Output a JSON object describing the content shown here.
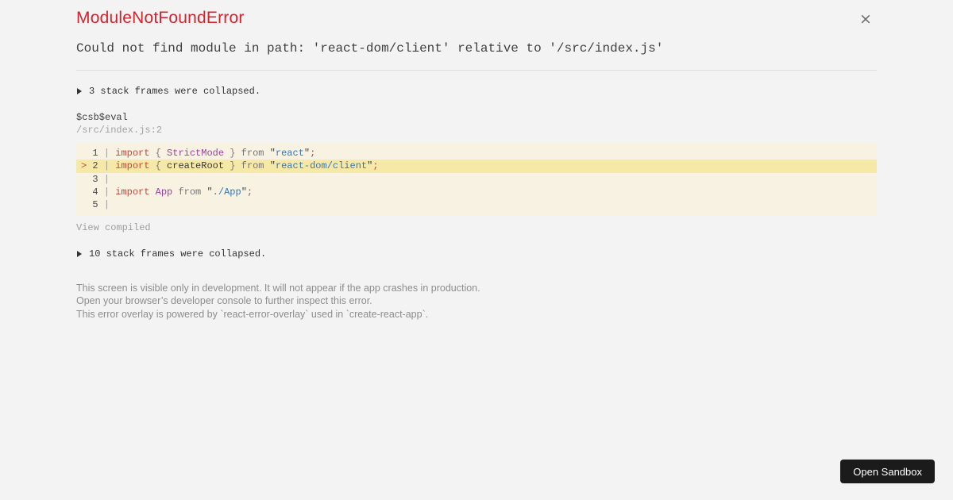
{
  "overlay": {
    "title": "ModuleNotFoundError",
    "title_color": "#d2232f",
    "close_label": "×",
    "message": "Could not find module in path: 'react-dom/client' relative to '/src/index.js'"
  },
  "stack": {
    "collapsed_top": "3 stack frames were collapsed.",
    "frame_name": "$csb$eval",
    "frame_location": "/src/index.js:2",
    "view_compiled": "View compiled",
    "collapsed_bottom": "10 stack frames were collapsed."
  },
  "code": {
    "background": "#f7f2e2",
    "highlight_background": "#f6e9a8",
    "colors": {
      "mk": "#d04540",
      "ln": "#4a4a4a",
      "pp": "#9a9a9a",
      "kw": "#c5493f",
      "pu": "#7a7a7a",
      "cn": "#a0449b",
      "pl": "#373737",
      "fr": "#757575",
      "df": "#373737",
      "qt": "#3f3f3f",
      "st": "#3a76ab",
      "sm": "#a8534a"
    },
    "lines": [
      {
        "num": "1",
        "highlight": false,
        "tokens": [
          [
            "kw",
            "import"
          ],
          [
            "pu",
            " { "
          ],
          [
            "cn",
            "StrictMode"
          ],
          [
            "pu",
            " } "
          ],
          [
            "fr",
            "from"
          ],
          [
            "df",
            " "
          ],
          [
            "qt",
            "\""
          ],
          [
            "st",
            "react"
          ],
          [
            "qt",
            "\""
          ],
          [
            "sm",
            ";"
          ]
        ]
      },
      {
        "num": "2",
        "highlight": true,
        "tokens": [
          [
            "kw",
            "import"
          ],
          [
            "pu",
            " { "
          ],
          [
            "pl",
            "createRoot"
          ],
          [
            "pu",
            " } "
          ],
          [
            "fr",
            "from"
          ],
          [
            "df",
            " "
          ],
          [
            "qt",
            "\""
          ],
          [
            "st",
            "react-dom/client"
          ],
          [
            "qt",
            "\""
          ],
          [
            "sm",
            ";"
          ]
        ]
      },
      {
        "num": "3",
        "highlight": false,
        "tokens": []
      },
      {
        "num": "4",
        "highlight": false,
        "tokens": [
          [
            "kw",
            "import"
          ],
          [
            "df",
            " "
          ],
          [
            "cn",
            "App"
          ],
          [
            "df",
            " "
          ],
          [
            "fr",
            "from"
          ],
          [
            "df",
            " "
          ],
          [
            "qt",
            "\""
          ],
          [
            "st",
            "./App"
          ],
          [
            "qt",
            "\""
          ],
          [
            "sm",
            ";"
          ]
        ]
      },
      {
        "num": "5",
        "highlight": false,
        "tokens": []
      }
    ]
  },
  "footer": {
    "line1": "This screen is visible only in development. It will not appear if the app crashes in production.",
    "line2": "Open your browser’s developer console to further inspect this error.",
    "line3": "This error overlay is powered by `react-error-overlay` used in `create-react-app`."
  },
  "open_sandbox": {
    "label": "Open Sandbox",
    "background": "#1b1b1b"
  }
}
